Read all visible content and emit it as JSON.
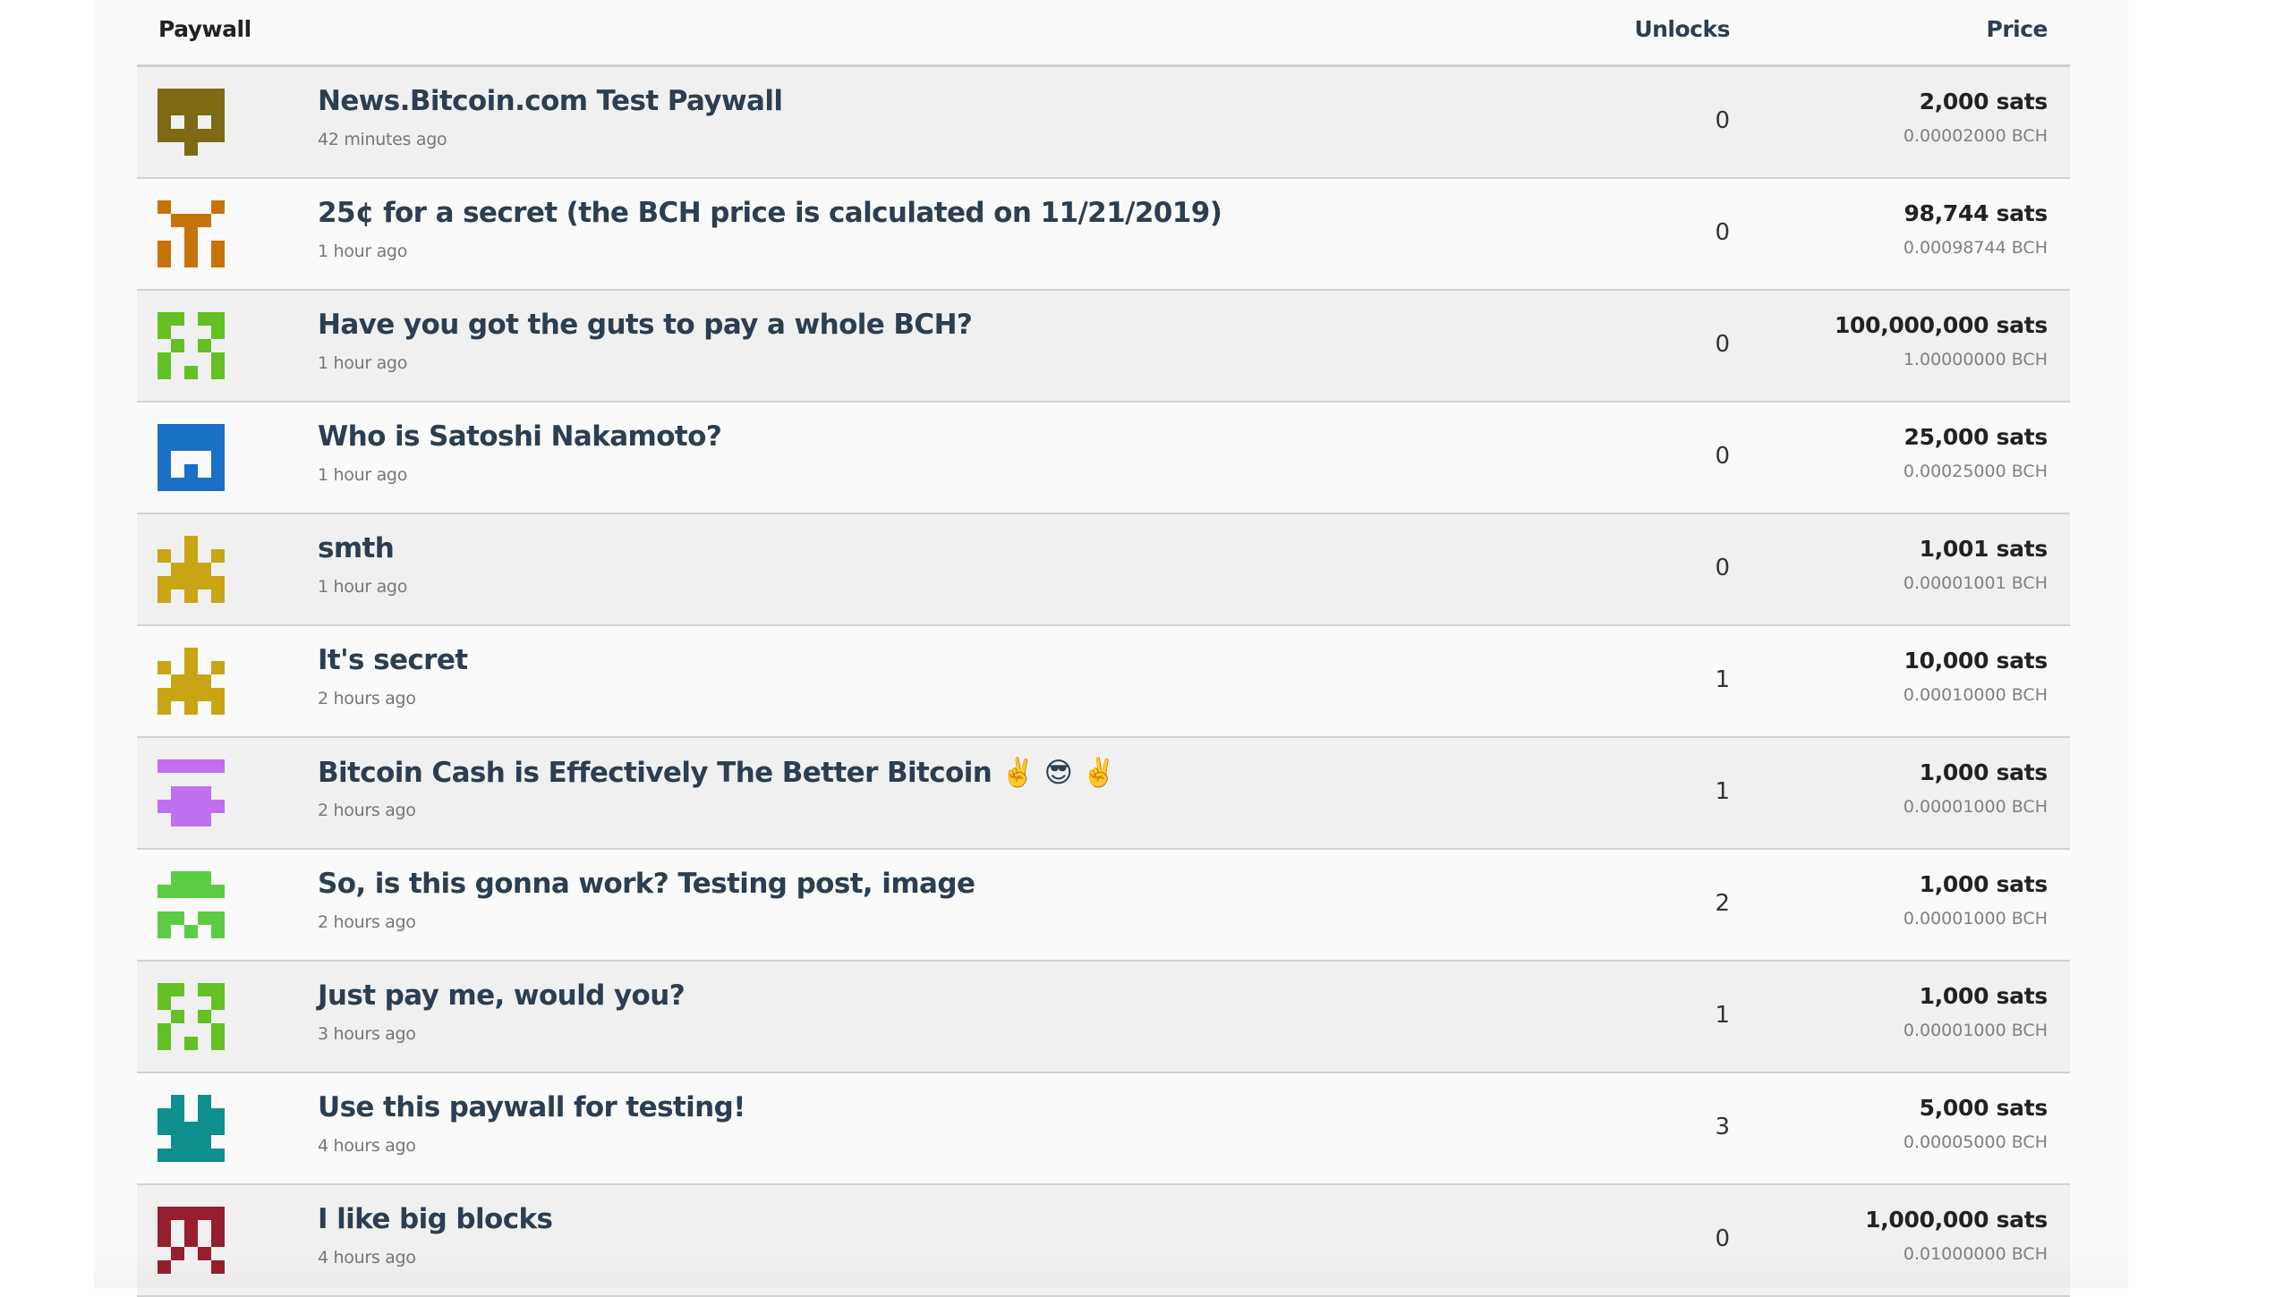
{
  "table": {
    "headers": {
      "paywall": "Paywall",
      "unlocks": "Unlocks",
      "price": "Price"
    },
    "rows": [
      {
        "title": "News.Bitcoin.com Test Paywall",
        "time": "42 minutes ago",
        "unlocks": "0",
        "price_sats": "2,000 sats",
        "price_bch": "0.00002000 BCH",
        "avatar": {
          "color": "#7d6a14",
          "pattern": [
            "11111",
            "11111",
            "10101",
            "11111",
            "00100"
          ]
        }
      },
      {
        "title": "25¢ for a secret (the BCH price is calculated on 11/21/2019)",
        "time": "1 hour ago",
        "unlocks": "0",
        "price_sats": "98,744 sats",
        "price_bch": "0.00098744 BCH",
        "avatar": {
          "color": "#c8720a",
          "pattern": [
            "10001",
            "01110",
            "00100",
            "10101",
            "10101"
          ]
        }
      },
      {
        "title": "Have you got the guts to pay a whole BCH?",
        "time": "1 hour ago",
        "unlocks": "0",
        "price_sats": "100,000,000 sats",
        "price_bch": "1.00000000 BCH",
        "avatar": {
          "color": "#64c024",
          "pattern": [
            "11011",
            "10001",
            "01010",
            "10001",
            "10101"
          ]
        }
      },
      {
        "title": "Who is Satoshi Nakamoto?",
        "time": "1 hour ago",
        "unlocks": "0",
        "price_sats": "25,000 sats",
        "price_bch": "0.00025000 BCH",
        "avatar": {
          "color": "#1a70c6",
          "pattern": [
            "11111",
            "11111",
            "10001",
            "10101",
            "11111"
          ]
        }
      },
      {
        "title": "smth",
        "time": "1 hour ago",
        "unlocks": "0",
        "price_sats": "1,001 sats",
        "price_bch": "0.00001001 BCH",
        "avatar": {
          "color": "#c9a414",
          "pattern": [
            "00100",
            "10101",
            "01110",
            "11111",
            "10101"
          ]
        }
      },
      {
        "title": "It's secret",
        "time": "2 hours ago",
        "unlocks": "1",
        "price_sats": "10,000 sats",
        "price_bch": "0.00010000 BCH",
        "avatar": {
          "color": "#c9a414",
          "pattern": [
            "00100",
            "10101",
            "01110",
            "11111",
            "10101"
          ]
        }
      },
      {
        "title": "Bitcoin Cash is Effectively The Better Bitcoin ✌️ 😎 ✌️",
        "time": "2 hours ago",
        "unlocks": "1",
        "price_sats": "1,000 sats",
        "price_bch": "0.00001000 BCH",
        "avatar": {
          "color": "#c070ee",
          "pattern": [
            "11111",
            "00000",
            "01110",
            "11111",
            "01110"
          ]
        }
      },
      {
        "title": "So, is this gonna work? Testing post, image",
        "time": "2 hours ago",
        "unlocks": "2",
        "price_sats": "1,000 sats",
        "price_bch": "0.00001000 BCH",
        "avatar": {
          "color": "#5ccc44",
          "pattern": [
            "01110",
            "11111",
            "00000",
            "11011",
            "10101"
          ]
        }
      },
      {
        "title": "Just pay me, would you?",
        "time": "3 hours ago",
        "unlocks": "1",
        "price_sats": "1,000 sats",
        "price_bch": "0.00001000 BCH",
        "avatar": {
          "color": "#64c024",
          "pattern": [
            "11011",
            "10001",
            "01010",
            "10001",
            "10101"
          ]
        }
      },
      {
        "title": "Use this paywall for testing!",
        "time": "4 hours ago",
        "unlocks": "3",
        "price_sats": "5,000 sats",
        "price_bch": "0.00005000 BCH",
        "avatar": {
          "color": "#0f8f8f",
          "pattern": [
            "01010",
            "11011",
            "11111",
            "01110",
            "11111"
          ]
        }
      },
      {
        "title": "I like big blocks",
        "time": "4 hours ago",
        "unlocks": "0",
        "price_sats": "1,000,000 sats",
        "price_bch": "0.01000000 BCH",
        "avatar": {
          "color": "#961e2e",
          "pattern": [
            "11111",
            "10101",
            "10101",
            "01010",
            "10001"
          ]
        }
      }
    ]
  }
}
